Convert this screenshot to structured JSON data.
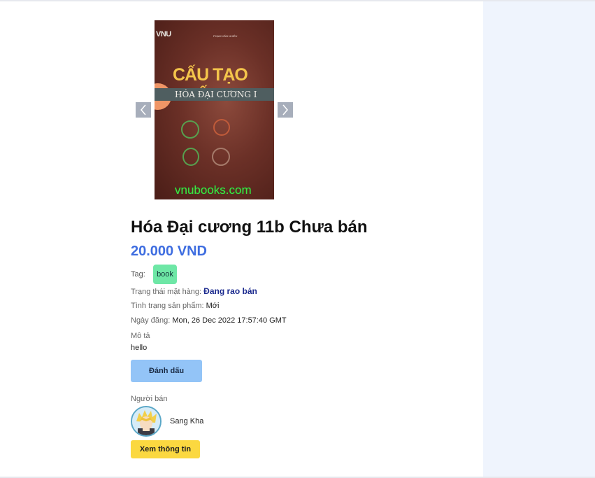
{
  "product": {
    "title": "Hóa Đại cương 11b Chưa bán",
    "price": "20.000 VND",
    "image": {
      "logo_text": "VNU",
      "author_text": "PHẠM VĂN NHIÊU",
      "cover_title": "CẤU TẠO CHẤT",
      "cover_subtitle": "HÓA ĐẠI CƯƠNG I",
      "watermark": "vnubooks.com"
    },
    "tag_label": "Tag:",
    "tag": "book",
    "status_label": "Trạng thái mặt hàng:",
    "status_value": "Đang rao bán",
    "condition_label": "Tình trạng sản phẩm:",
    "condition_value": "Mới",
    "date_label": "Ngày đăng:",
    "date_value": "Mon, 26 Dec 2022 17:57:40 GMT",
    "description_label": "Mô tả",
    "description_value": "hello"
  },
  "actions": {
    "bookmark_label": "Đánh dấu",
    "view_info_label": "Xem thông tin"
  },
  "seller": {
    "label": "Người bán",
    "name": "Sang Kha"
  },
  "carousel": {
    "prev_icon": "chevron-left-icon",
    "next_icon": "chevron-right-icon"
  },
  "colors": {
    "price": "#3e6de0",
    "tag_bg": "#6ee7a6",
    "bookmark_bg": "#93c4f7",
    "view_bg": "#fbd840",
    "status": "#1c2b8f",
    "page_bg": "#eff4fd"
  }
}
